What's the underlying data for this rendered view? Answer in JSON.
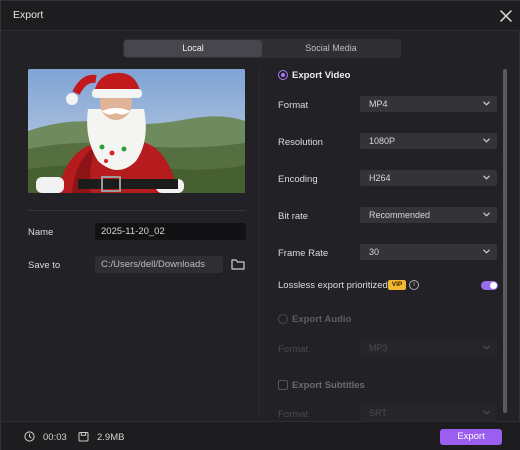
{
  "window": {
    "title": "Export"
  },
  "tabs": [
    {
      "label": "Local",
      "active": true
    },
    {
      "label": "Social Media",
      "active": false
    }
  ],
  "left": {
    "name_label": "Name",
    "name_value": "2025-11-20_02",
    "saveto_label": "Save to",
    "saveto_value": "C:/Users/dell/Downloads"
  },
  "video": {
    "title": "Export Video",
    "settings": [
      {
        "label": "Format",
        "value": "MP4"
      },
      {
        "label": "Resolution",
        "value": "1080P"
      },
      {
        "label": "Encoding",
        "value": "H264"
      },
      {
        "label": "Bit rate",
        "value": "Recommended"
      },
      {
        "label": "Frame Rate",
        "value": "30"
      }
    ],
    "lossless_label": "Lossless export prioritized",
    "vip_badge": "VIP",
    "lossless_enabled": true
  },
  "audio": {
    "title": "Export Audio",
    "format_label": "Format",
    "format_value": "MP3"
  },
  "subtitles": {
    "title": "Export Subtitles",
    "format_label": "Format",
    "format_value": "SRT"
  },
  "footer": {
    "duration": "00:03",
    "size": "2.9MB",
    "export_label": "Export"
  },
  "colors": {
    "accent": "#9a5ef0",
    "vip": "#f2b733",
    "background": "#222226"
  },
  "icons": [
    "close-icon",
    "folder-icon",
    "chevron-down-icon",
    "info-icon",
    "clock-icon",
    "file-size-icon"
  ]
}
